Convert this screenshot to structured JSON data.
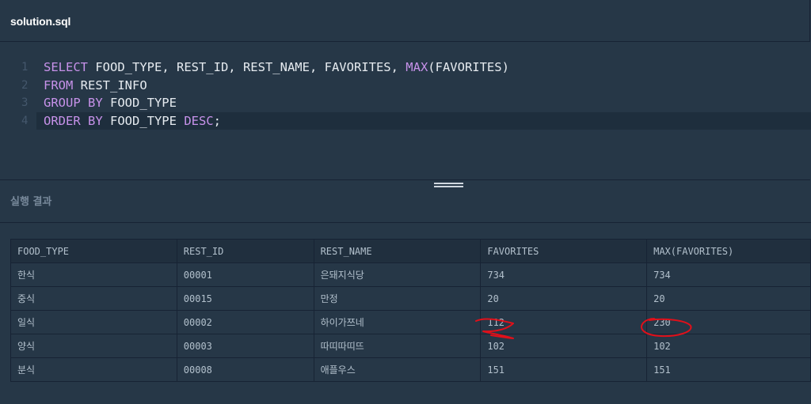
{
  "file": {
    "name": "solution.sql"
  },
  "editor": {
    "lines": [
      {
        "number": "1",
        "tokens": [
          {
            "t": "SELECT",
            "c": "kw"
          },
          {
            "t": " FOOD_TYPE, REST_ID, REST_NAME, FAVORITES, ",
            "c": "id"
          },
          {
            "t": "MAX",
            "c": "fn"
          },
          {
            "t": "(FAVORITES)",
            "c": "id"
          }
        ]
      },
      {
        "number": "2",
        "tokens": [
          {
            "t": "FROM",
            "c": "kw"
          },
          {
            "t": " REST_INFO",
            "c": "id"
          }
        ]
      },
      {
        "number": "3",
        "tokens": [
          {
            "t": "GROUP BY",
            "c": "kw"
          },
          {
            "t": " FOOD_TYPE",
            "c": "id"
          }
        ]
      },
      {
        "number": "4",
        "tokens": [
          {
            "t": "ORDER BY",
            "c": "kw"
          },
          {
            "t": " FOOD_TYPE ",
            "c": "id"
          },
          {
            "t": "DESC",
            "c": "kw"
          },
          {
            "t": ";",
            "c": "id"
          }
        ]
      }
    ]
  },
  "results": {
    "title": "실행 결과",
    "columns": [
      "FOOD_TYPE",
      "REST_ID",
      "REST_NAME",
      "FAVORITES",
      "MAX(FAVORITES)"
    ],
    "rows": [
      [
        "한식",
        "00001",
        "은돼지식당",
        "734",
        "734"
      ],
      [
        "중식",
        "00015",
        "만정",
        "20",
        "20"
      ],
      [
        "일식",
        "00002",
        "하이가쯔네",
        "112",
        "230"
      ],
      [
        "양식",
        "00003",
        "따띠따띠뜨",
        "102",
        "102"
      ],
      [
        "분식",
        "00008",
        "애플우스",
        "151",
        "151"
      ]
    ]
  },
  "colors": {
    "background": "#263747",
    "keyword": "#c792ea",
    "annotation": "#e0101a"
  }
}
